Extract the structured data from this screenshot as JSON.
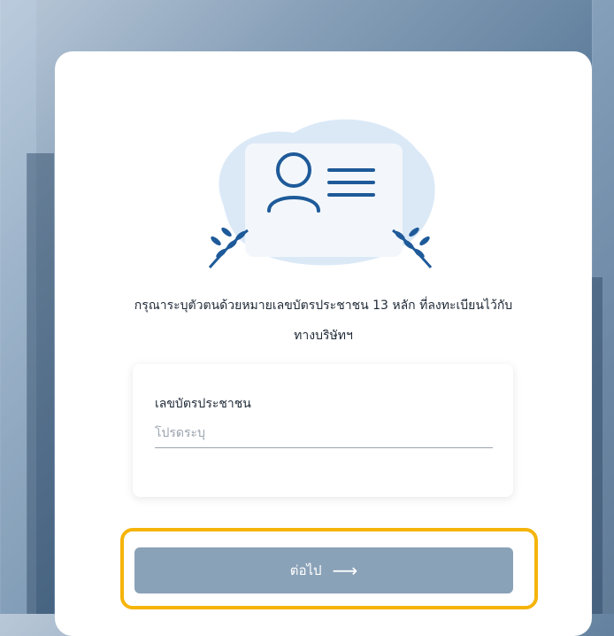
{
  "message": {
    "line1": "กรุณาระบุตัวตนด้วยหมายเลขบัตรประชาชน 13 หลัก ที่ลงทะเบียนไว้กับ",
    "line2": "ทางบริษัทฯ"
  },
  "id_field": {
    "label": "เลขบัตรประชาชน",
    "placeholder": "โปรดระบุ",
    "value": ""
  },
  "next_button": {
    "label": "ต่อไป",
    "icon": "arrow-right-icon"
  },
  "colors": {
    "accent": "#8aa2b8",
    "highlight": "#f5b40a",
    "illustration_blue": "#1e5a99",
    "blob": "#dbe9f7"
  }
}
